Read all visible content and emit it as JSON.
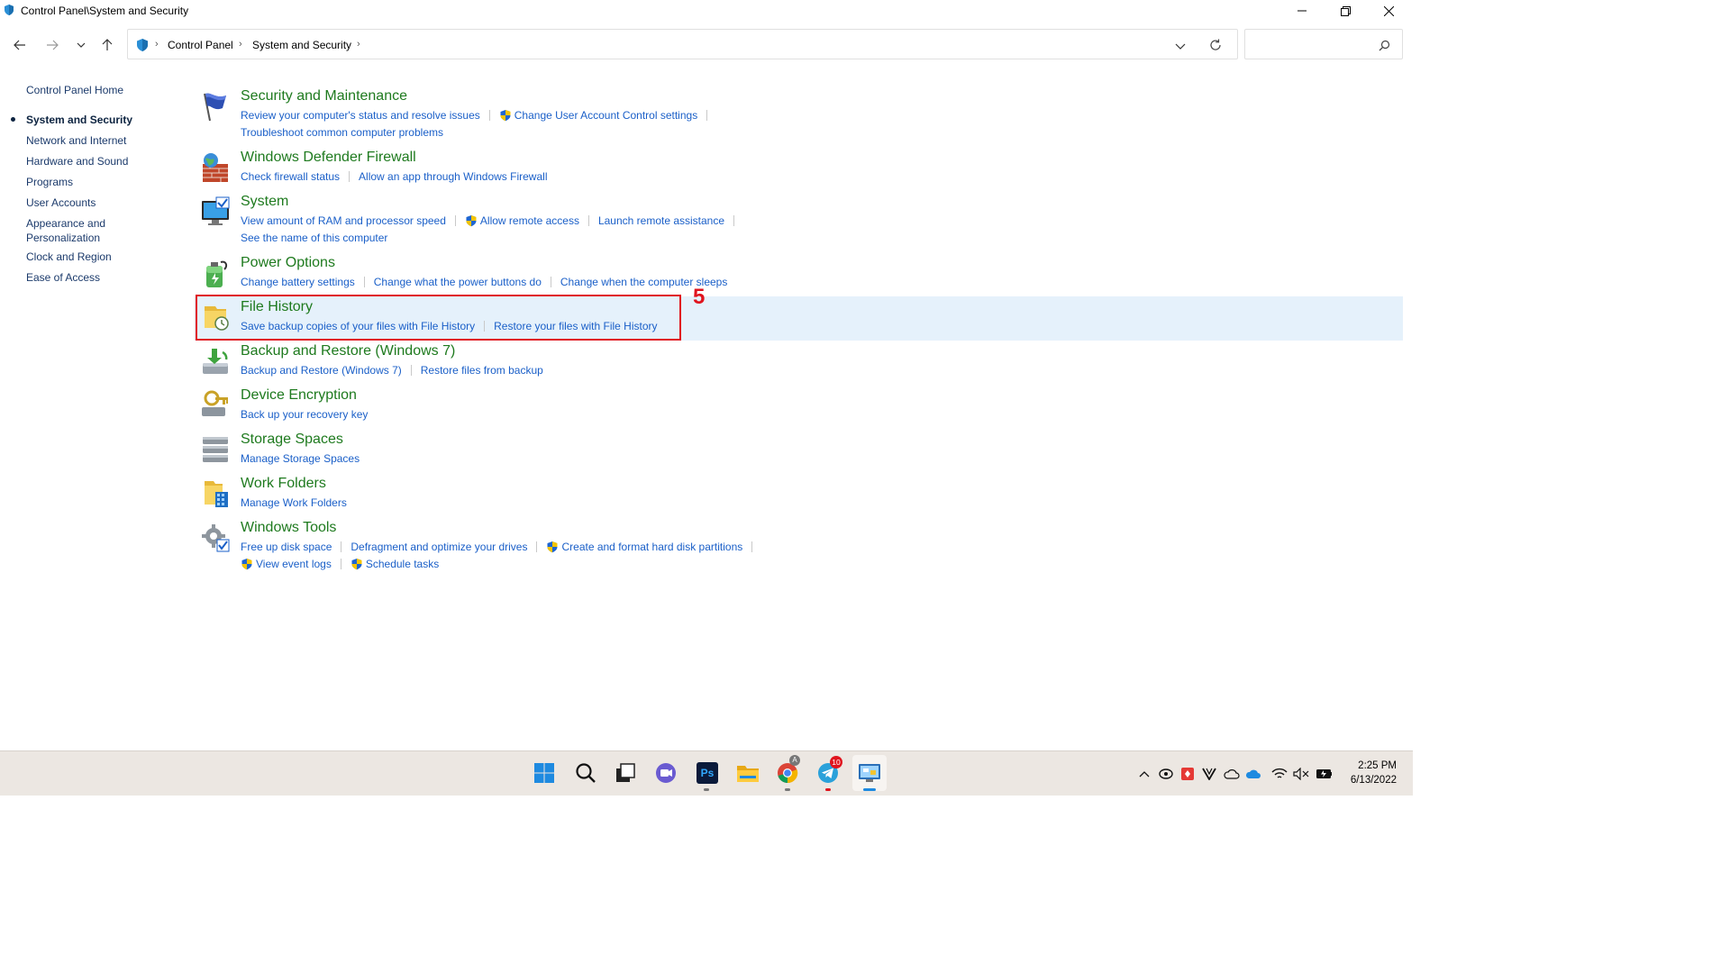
{
  "window": {
    "title": "Control Panel\\System and Security"
  },
  "address": {
    "crumbs": [
      "Control Panel",
      "System and Security"
    ],
    "search_placeholder": ""
  },
  "leftnav": {
    "items": [
      {
        "label": "Control Panel Home",
        "active": false
      },
      {
        "label": "System and Security",
        "active": true
      },
      {
        "label": "Network and Internet",
        "active": false
      },
      {
        "label": "Hardware and Sound",
        "active": false
      },
      {
        "label": "Programs",
        "active": false
      },
      {
        "label": "User Accounts",
        "active": false
      },
      {
        "label": "Appearance and",
        "active": false
      },
      {
        "label": "Personalization",
        "active": false
      },
      {
        "label": "Clock and Region",
        "active": false
      },
      {
        "label": "Ease of Access",
        "active": false
      }
    ]
  },
  "categories": [
    {
      "title": "Security and Maintenance",
      "icon": "flag-icon",
      "links": [
        "Review your computer's status and resolve issues",
        "Change User Account Control settings",
        "Troubleshoot common computer problems"
      ]
    },
    {
      "title": "Windows Defender Firewall",
      "icon": "firewall-icon",
      "links": [
        "Check firewall status",
        "Allow an app through Windows Firewall"
      ]
    },
    {
      "title": "System",
      "icon": "monitor-icon",
      "links": [
        "View amount of RAM and processor speed",
        "Allow remote access",
        "Launch remote assistance",
        "See the name of this computer"
      ]
    },
    {
      "title": "Power Options",
      "icon": "battery-icon",
      "links": [
        "Change battery settings",
        "Change what the power buttons do",
        "Change when the computer sleeps"
      ]
    },
    {
      "title": "File History",
      "icon": "file-history-icon",
      "links": [
        "Save backup copies of your files with File History",
        "Restore your files with File History"
      ]
    },
    {
      "title": "Backup and Restore (Windows 7)",
      "icon": "backup-icon",
      "links": [
        "Backup and Restore (Windows 7)",
        "Restore files from backup"
      ]
    },
    {
      "title": "Device Encryption",
      "icon": "key-icon",
      "links": [
        "Back up your recovery key"
      ]
    },
    {
      "title": "Storage Spaces",
      "icon": "storage-icon",
      "links": [
        "Manage Storage Spaces"
      ]
    },
    {
      "title": "Work Folders",
      "icon": "work-folders-icon",
      "links": [
        "Manage Work Folders"
      ]
    },
    {
      "title": "Windows Tools",
      "icon": "tools-icon",
      "links": [
        "Free up disk space",
        "Defragment and optimize your drives",
        "Create and format hard disk partitions",
        "View event logs",
        "Schedule tasks"
      ]
    }
  ],
  "annotation": {
    "step_number": "5",
    "color": "#e0141e"
  },
  "taskbar": {
    "apps": [
      "windows-start-icon",
      "search-icon",
      "task-view-icon",
      "chat-icon",
      "photoshop-icon",
      "file-explorer-icon",
      "chrome-icon",
      "telegram-icon",
      "control-panel-icon"
    ],
    "photoshop_label": "Ps",
    "telegram_badge": "10",
    "chrome_badge": "A",
    "time": "2:25 PM",
    "date": "6/13/2022"
  },
  "colors": {
    "link": "#1a5fc8",
    "category_title": "#1e7a1e",
    "highlight_row": "#e5f1fb"
  }
}
